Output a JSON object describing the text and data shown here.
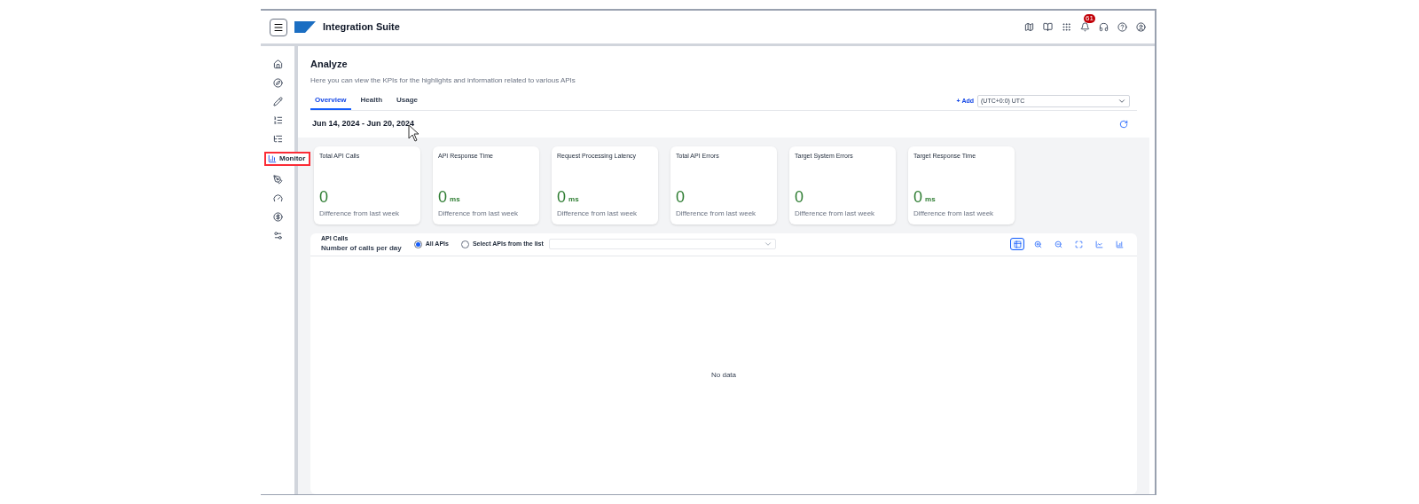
{
  "header": {
    "title": "Integration Suite",
    "notification_badge": "61"
  },
  "sidebar": {
    "items": [
      {
        "selected": false
      },
      {
        "selected": false
      },
      {
        "selected": false
      },
      {
        "selected": false
      },
      {
        "selected": false
      },
      {
        "label": "Monitor",
        "selected": true
      },
      {
        "selected": false
      },
      {
        "selected": false
      },
      {
        "selected": false
      },
      {
        "selected": false
      }
    ]
  },
  "page": {
    "title": "Analyze",
    "subtitle": "Here you can view the KPIs for the highlights and information related to various APIs",
    "tabs": [
      {
        "label": "Overview",
        "selected": true
      },
      {
        "label": "Health",
        "selected": false
      },
      {
        "label": "Usage",
        "selected": false
      }
    ],
    "add_link": "+ Add",
    "timezone": {
      "value": "(UTC+0:0) UTC"
    },
    "date_range": "Jun 14, 2024 - Jun 20, 2024",
    "kpis": [
      {
        "title": "Total API Calls",
        "value": "0",
        "caption": "Difference from last week"
      },
      {
        "title": "API Response Time",
        "value": "0",
        "unit": "ms",
        "caption": "Difference from last week"
      },
      {
        "title": "Request Processing Latency",
        "value": "0",
        "unit": "ms",
        "caption": "Difference from last week"
      },
      {
        "title": "Total API Errors",
        "value": "0",
        "caption": "Difference from last week"
      },
      {
        "title": "Target System Errors",
        "value": "0",
        "caption": "Difference from last week"
      },
      {
        "title": "Target Response Time",
        "value": "0",
        "unit": "ms",
        "caption": "Difference from last week"
      }
    ],
    "chart_panel": {
      "title": "API Calls",
      "subtitle": "Number of calls per day",
      "radios": [
        {
          "label": "All APIs",
          "selected": true
        },
        {
          "label": "Select APIs from the list",
          "selected": false
        }
      ],
      "toolbar": [
        {
          "selected": true
        },
        {
          "selected": false
        },
        {
          "selected": false
        },
        {
          "selected": false
        },
        {
          "selected": false
        },
        {
          "selected": false
        }
      ],
      "empty_message": "No data"
    }
  }
}
